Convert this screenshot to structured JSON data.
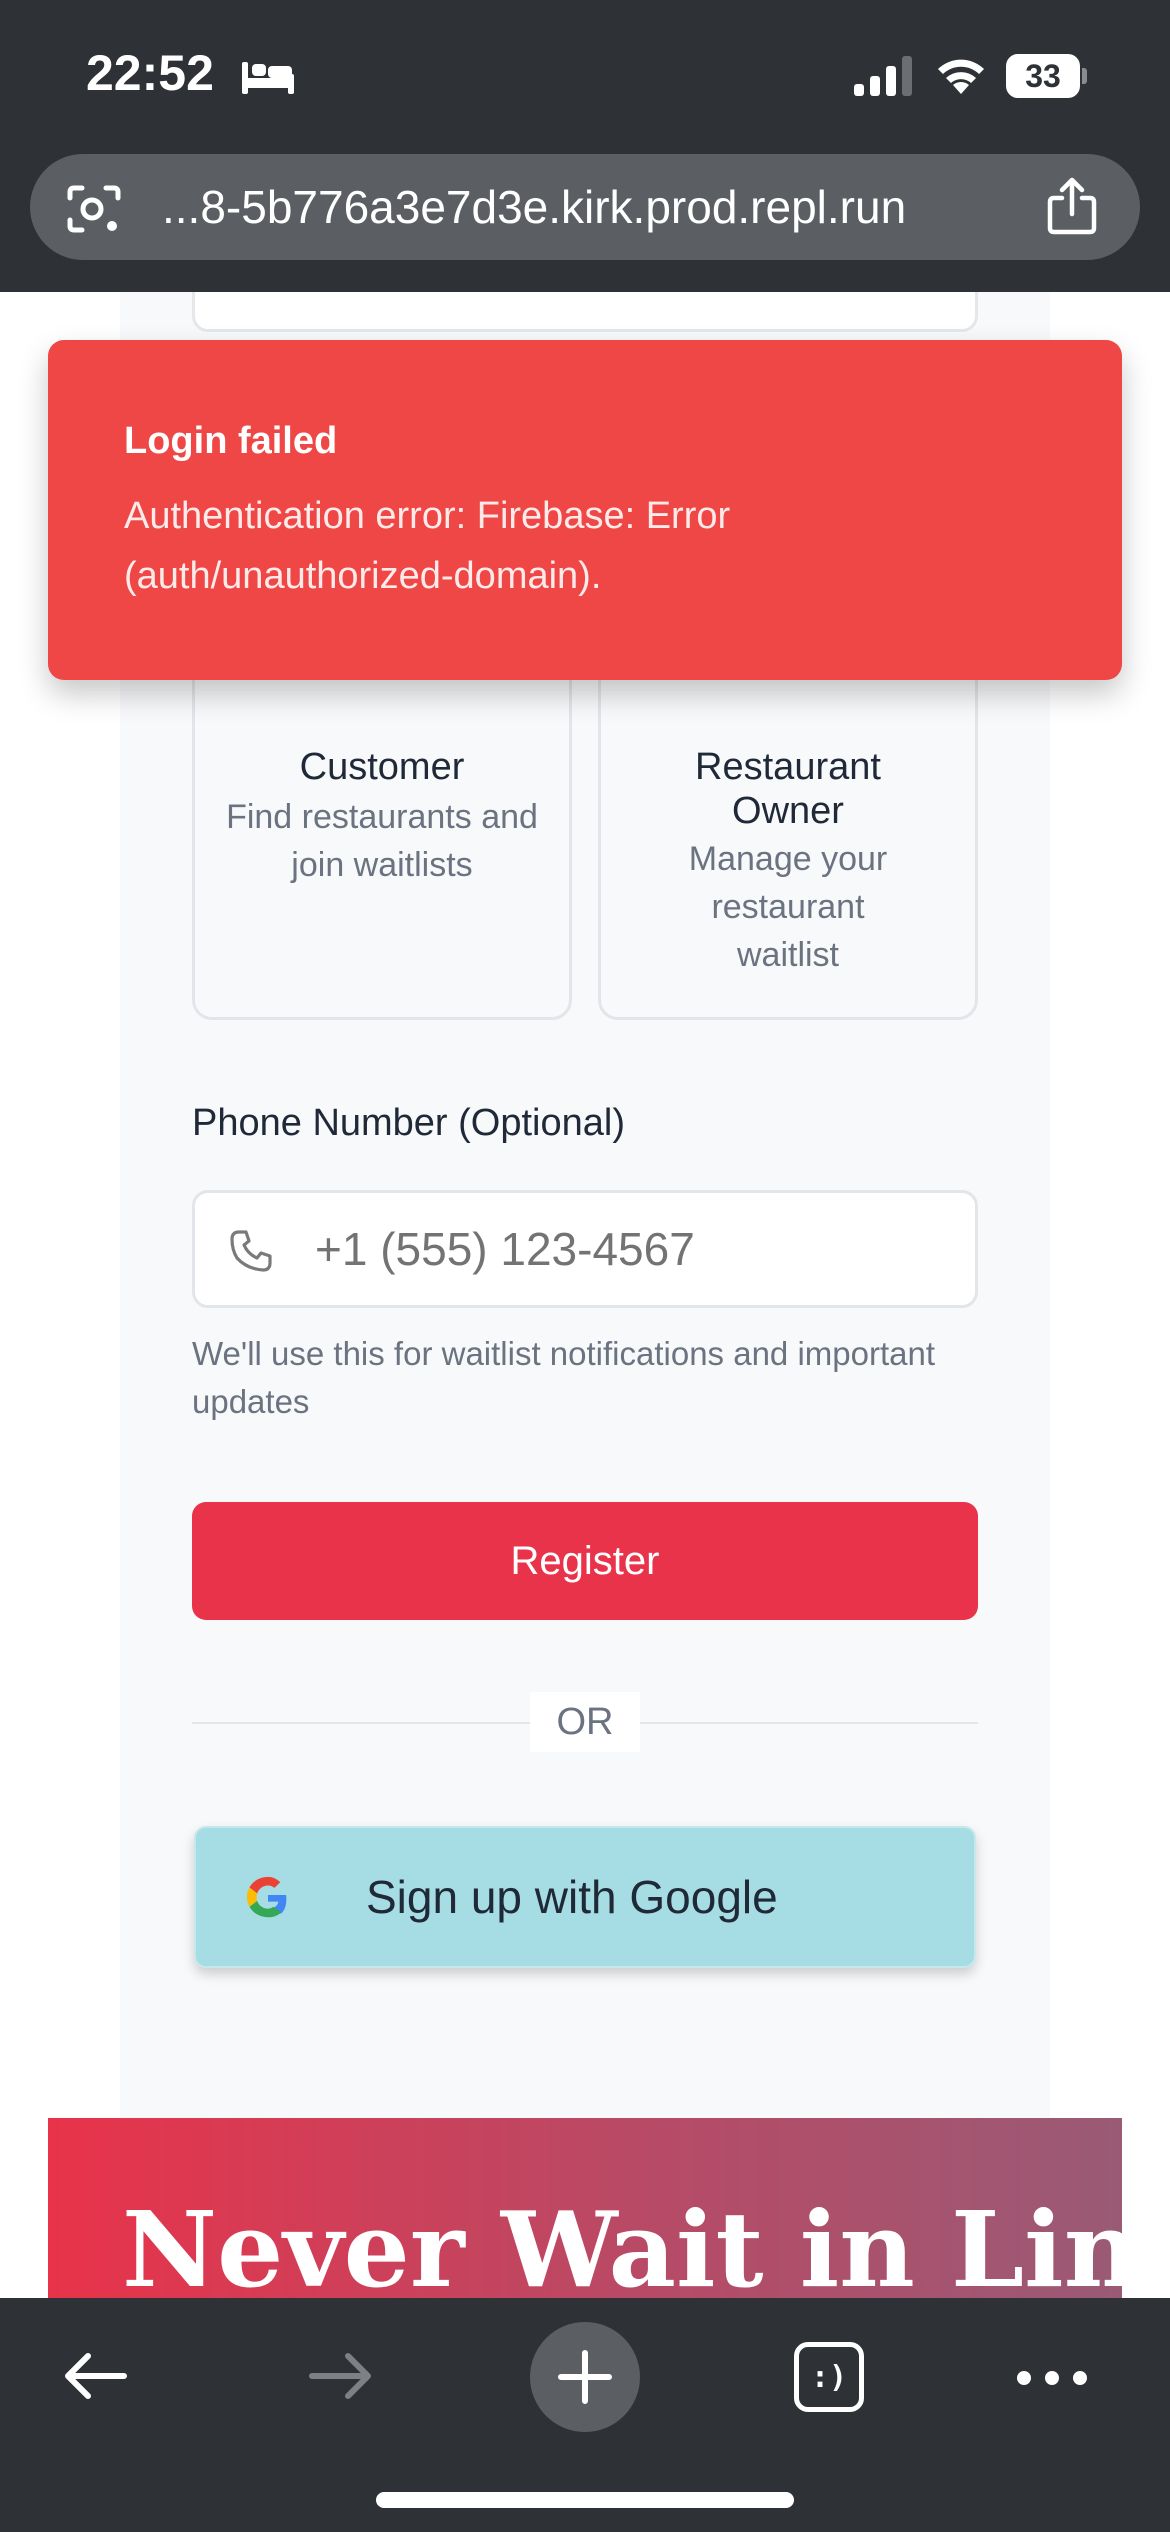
{
  "status_bar": {
    "time": "22:52",
    "battery_level": "33"
  },
  "browser": {
    "url": "...8-5b776a3e7d3e.kirk.prod.repl.run",
    "tabs_label": ":)"
  },
  "toast": {
    "title": "Login failed",
    "message": "Authentication error: Firebase: Error (auth/unauthorized-domain)."
  },
  "roles": [
    {
      "title": "Customer",
      "description": "Find restaurants and join waitlists"
    },
    {
      "title": "Restaurant Owner",
      "description": "Manage your restaurant waitlist"
    }
  ],
  "phone": {
    "label": "Phone Number (Optional)",
    "placeholder": "+1 (555) 123-4567",
    "help": "We'll use this for waitlist notifications and important updates"
  },
  "actions": {
    "register_label": "Register",
    "divider_label": "OR",
    "google_label": "Sign up with Google"
  },
  "hero": {
    "title": "Never Wait in Line"
  },
  "colors": {
    "primary": "#e8334a",
    "toast_bg": "#ef4646",
    "google_button_bg": "#a6dce3",
    "chrome_bg": "#2e3236"
  }
}
